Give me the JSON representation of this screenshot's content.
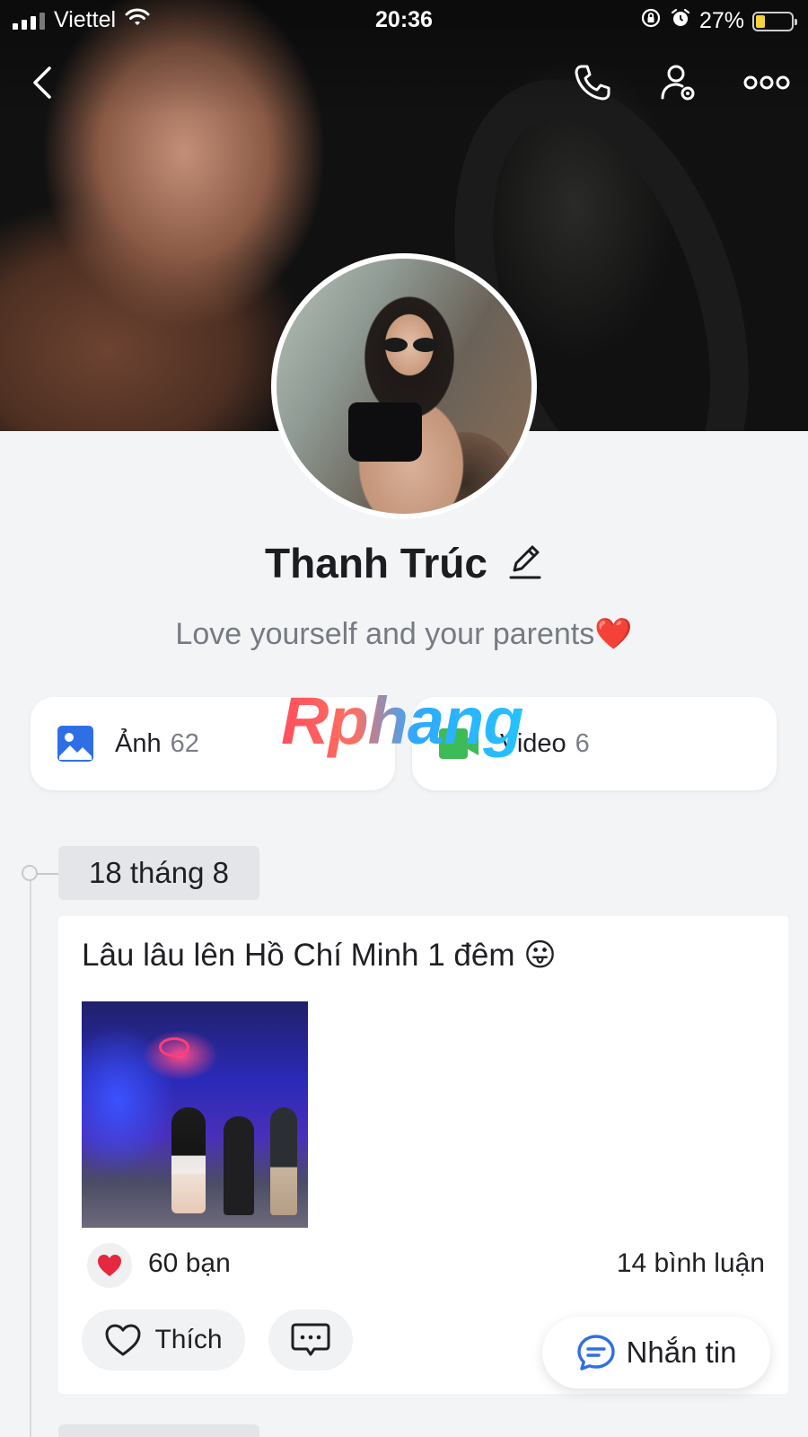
{
  "status_bar": {
    "carrier": "Viettel",
    "time": "20:36",
    "battery_percent": "27%",
    "battery_level": 0.27,
    "icons": [
      "signal-icon",
      "wifi-icon",
      "orientation-lock-icon",
      "alarm-icon",
      "battery-charging-icon"
    ]
  },
  "nav": {
    "icons": [
      "back-icon",
      "phone-icon",
      "user-settings-icon",
      "more-icon"
    ]
  },
  "profile": {
    "name": "Thanh Trúc",
    "bio": "Love yourself and your parents❤️"
  },
  "media": {
    "photos_label": "Ảnh",
    "photos_count": "62",
    "videos_label": "Video",
    "videos_count": "6",
    "colors": {
      "photo_icon": "#2f6fe6",
      "video_icon": "#3dbb57"
    }
  },
  "watermark": "Rphang",
  "timeline": {
    "date": "18 tháng 8",
    "post": {
      "text": "Lâu lâu lên Hồ Chí Minh 1 đêm 😛",
      "reactions": "60 bạn",
      "comments": "14 bình luận",
      "like_label": "Thích"
    }
  },
  "message_button": {
    "label": "Nhắn tin",
    "color": "#2f6fe6"
  }
}
